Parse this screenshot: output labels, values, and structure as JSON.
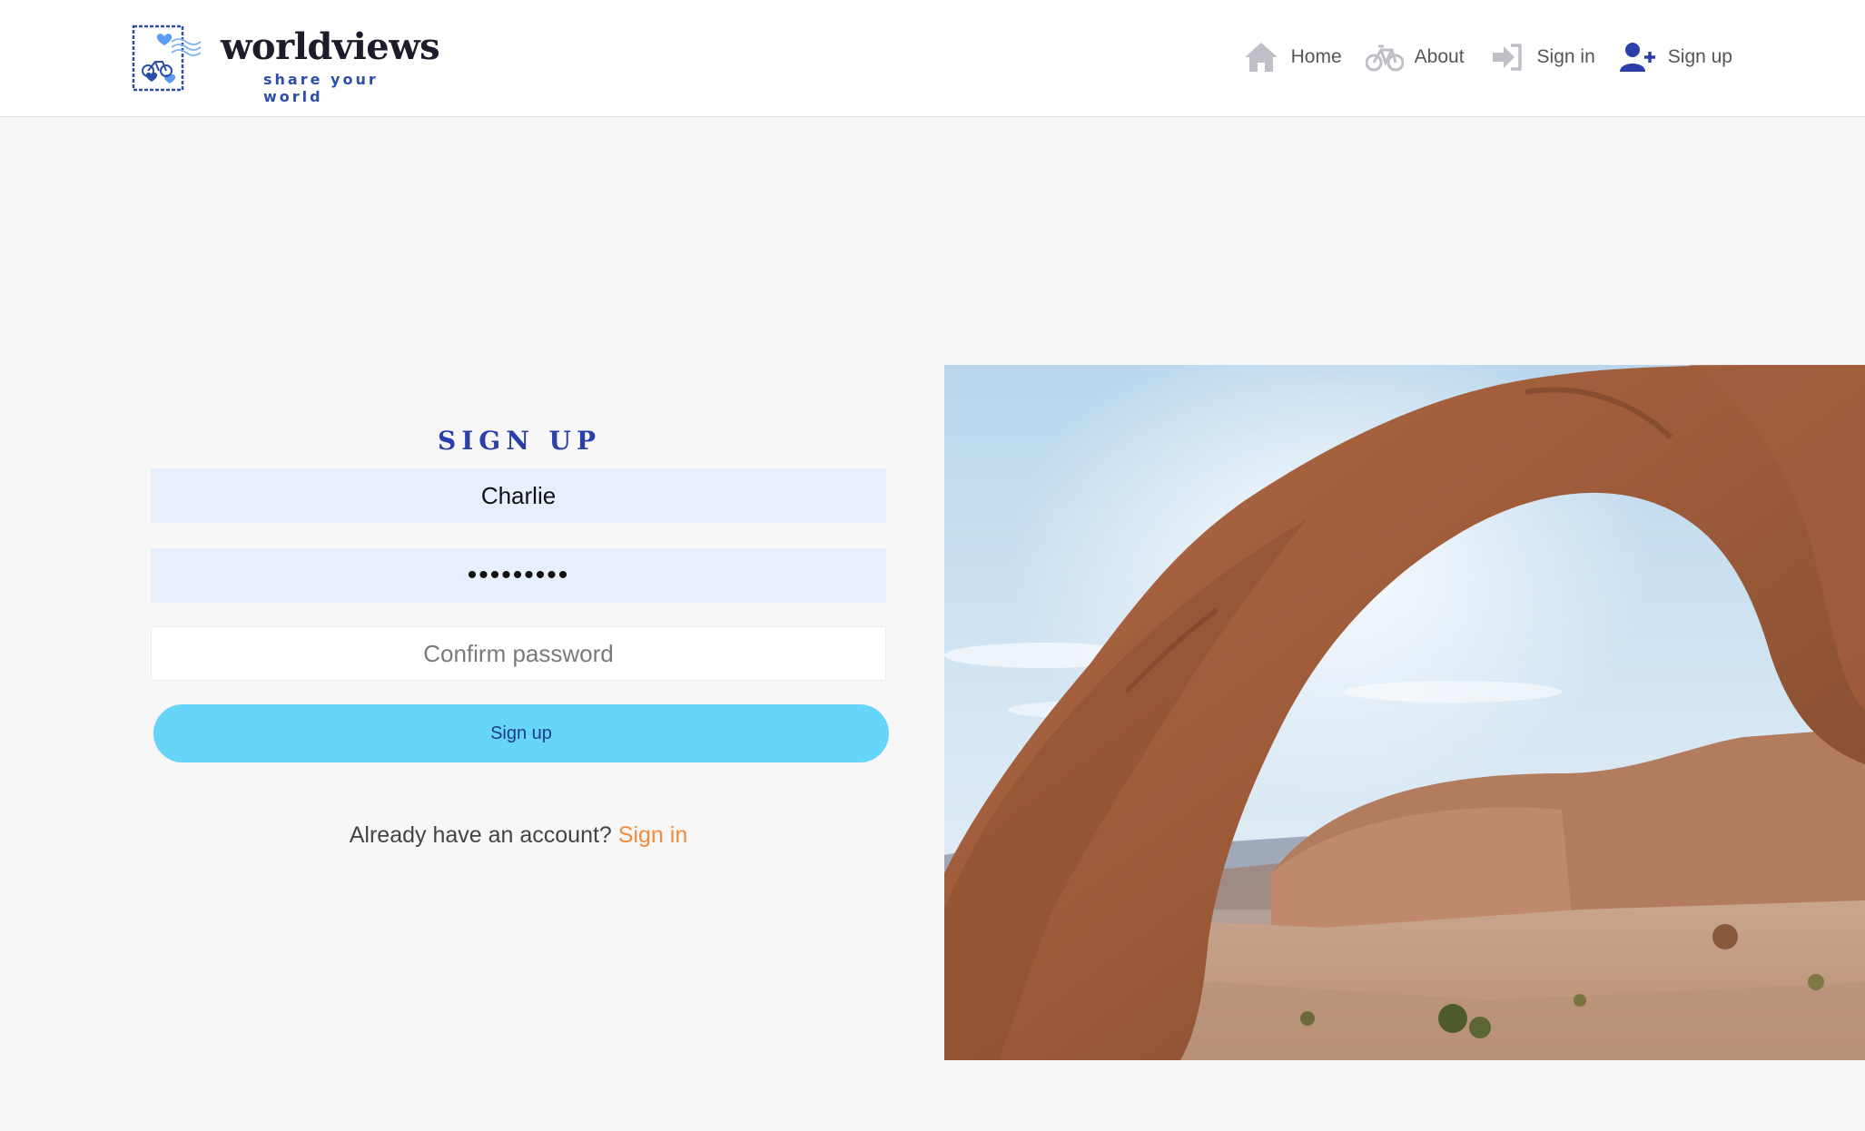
{
  "brand": {
    "name": "worldviews",
    "tagline": "share your world"
  },
  "nav": {
    "items": [
      {
        "label": "Home",
        "icon": "home-icon"
      },
      {
        "label": "About",
        "icon": "bicycle-icon"
      },
      {
        "label": "Sign in",
        "icon": "sign-in-icon"
      },
      {
        "label": "Sign up",
        "icon": "user-plus-icon"
      }
    ],
    "active": "Sign up"
  },
  "form": {
    "title": "SIGN UP",
    "username_value": "Charlie",
    "password_value": "•••••••••",
    "confirm_placeholder": "Confirm password",
    "submit_label": "Sign up",
    "already_text": "Already have an account?",
    "signin_link": "Sign in"
  },
  "colors": {
    "accent": "#2a3fa8",
    "button": "#67d5f8",
    "link": "#f28c3b",
    "input_filled": "#e8effc"
  },
  "hero_image": {
    "subject": "sandstone-arch-desert-photo"
  }
}
